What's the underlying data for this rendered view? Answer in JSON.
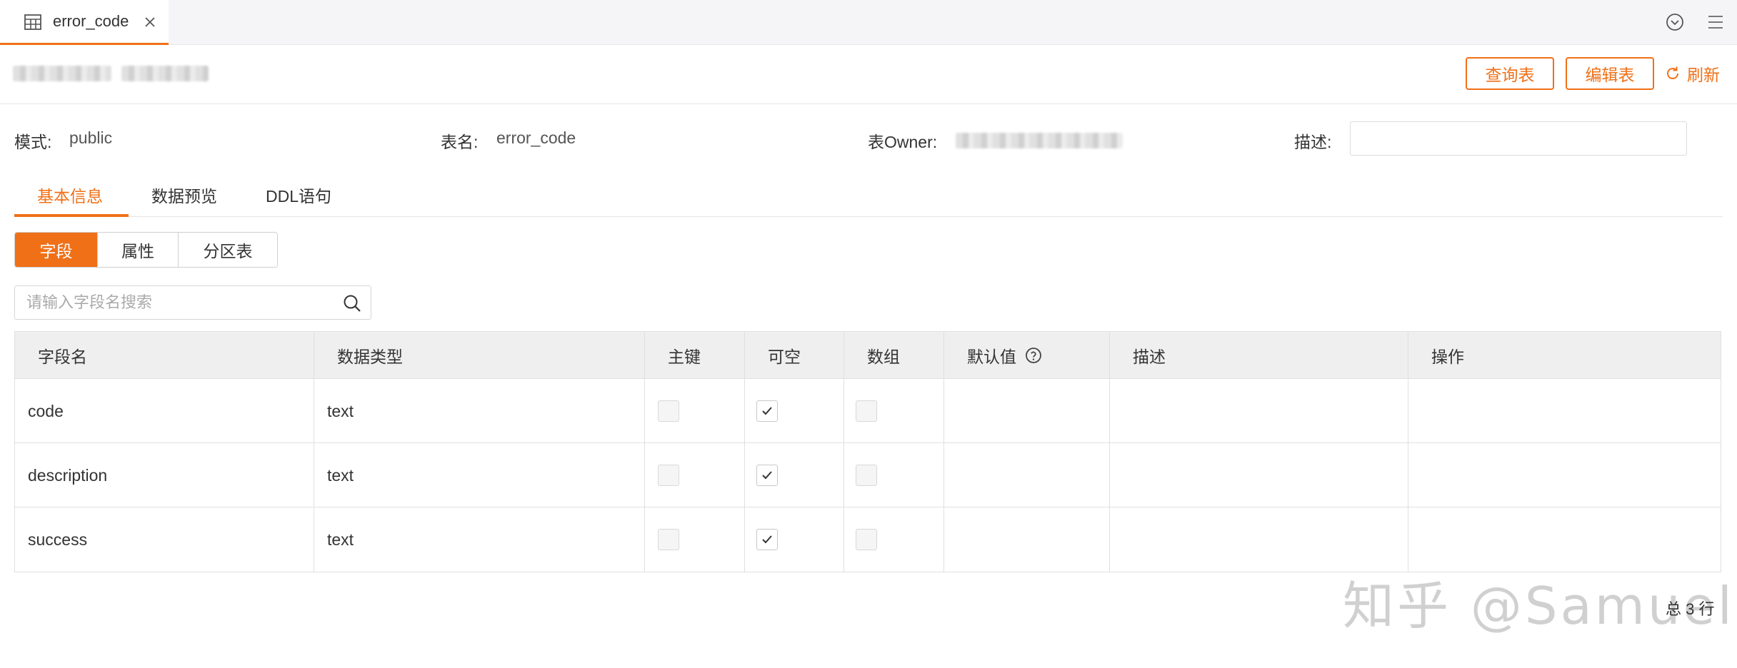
{
  "tab_bar": {
    "tab_label": "error_code"
  },
  "header": {
    "buttons": {
      "query_table": "查询表",
      "edit_table": "编辑表",
      "refresh": "刷新"
    }
  },
  "info": {
    "schema_label": "模式:",
    "schema_value": "public",
    "table_name_label": "表名:",
    "table_name_value": "error_code",
    "owner_label": "表Owner:",
    "description_label": "描述:"
  },
  "tabs": [
    "基本信息",
    "数据预览",
    "DDL语句"
  ],
  "segments": [
    "字段",
    "属性",
    "分区表"
  ],
  "search": {
    "placeholder": "请输入字段名搜索"
  },
  "table": {
    "columns": [
      "字段名",
      "数据类型",
      "主键",
      "可空",
      "数组",
      "默认值",
      "描述",
      "操作"
    ],
    "rows": [
      {
        "name": "code",
        "type": "text",
        "primary_key": false,
        "nullable": true,
        "array": false,
        "default": "",
        "description": ""
      },
      {
        "name": "description",
        "type": "text",
        "primary_key": false,
        "nullable": true,
        "array": false,
        "default": "",
        "description": ""
      },
      {
        "name": "success",
        "type": "text",
        "primary_key": false,
        "nullable": true,
        "array": false,
        "default": "",
        "description": ""
      }
    ]
  },
  "footer": {
    "total": "总 3 行"
  },
  "watermark": "知乎 @Samuel",
  "colors": {
    "accent": "#f07018",
    "header_bg": "#efefef",
    "border": "#e0e0e0"
  }
}
